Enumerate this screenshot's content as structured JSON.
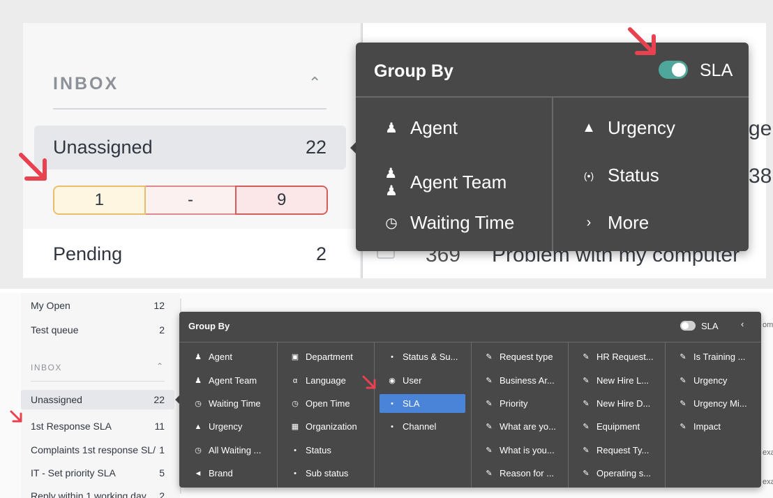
{
  "top": {
    "sidebar": {
      "section_title": "INBOX",
      "active_row": {
        "label": "Unassigned",
        "count": "22"
      },
      "sla_breakdown": [
        "1",
        "-",
        "9"
      ],
      "next_row": {
        "label": "Pending",
        "count": "2"
      }
    },
    "background_fragments": [
      "ge",
      "38",
      "Problem with my computer",
      "369"
    ],
    "popover": {
      "title": "Group By",
      "sla_toggle": {
        "label": "SLA",
        "on": true
      },
      "left_items": [
        {
          "label": "Agent",
          "icon": "person-icon"
        },
        {
          "label": "Agent Team",
          "icon": "people-icon"
        },
        {
          "label": "Waiting Time",
          "icon": "clock-icon"
        }
      ],
      "right_items": [
        {
          "label": "Urgency",
          "icon": "warning-icon"
        },
        {
          "label": "Status",
          "icon": "signal-icon"
        },
        {
          "label": "More",
          "icon": "chevron-right-icon"
        }
      ]
    }
  },
  "bottom": {
    "sidebar": {
      "top_items": [
        {
          "label": "My Open",
          "count": "12"
        },
        {
          "label": "Test queue",
          "count": "2"
        }
      ],
      "section_title": "INBOX",
      "active_row": {
        "label": "Unassigned",
        "count": "22"
      },
      "sla_items": [
        {
          "label": "1st Response SLA",
          "count": "11"
        },
        {
          "label": "Complaints 1st response SL/",
          "count": "1"
        },
        {
          "label": "IT - Set priority SLA",
          "count": "5"
        },
        {
          "label": "Reply within 1 working day",
          "count": "2"
        }
      ]
    },
    "background_fragments": [
      "om",
      "exa",
      "exa"
    ],
    "popover": {
      "title": "Group By",
      "sla_toggle": {
        "label": "SLA",
        "on": false
      },
      "close_icon": "chevron-left-icon",
      "columns": [
        [
          {
            "label": "Agent",
            "icon": "person-icon"
          },
          {
            "label": "Agent Team",
            "icon": "people-icon"
          },
          {
            "label": "Waiting Time",
            "icon": "clock-icon"
          },
          {
            "label": "Urgency",
            "icon": "warning-icon"
          },
          {
            "label": "All Waiting ...",
            "icon": "clock-icon"
          },
          {
            "label": "Brand",
            "icon": "megaphone-icon"
          }
        ],
        [
          {
            "label": "Department",
            "icon": "department-icon"
          },
          {
            "label": "Language",
            "icon": "translate-icon"
          },
          {
            "label": "Open Time",
            "icon": "clock-icon"
          },
          {
            "label": "Organization",
            "icon": "building-icon"
          },
          {
            "label": "Status",
            "icon": "signal-icon"
          },
          {
            "label": "Sub status",
            "icon": "signal-icon"
          }
        ],
        [
          {
            "label": "Status & Su...",
            "icon": "signal-icon"
          },
          {
            "label": "User",
            "icon": "user-circle-icon"
          },
          {
            "label": "SLA",
            "icon": "signal-icon",
            "selected": true
          },
          {
            "label": "Channel",
            "icon": "signal-icon"
          }
        ],
        [
          {
            "label": "Request type",
            "icon": "edit-icon"
          },
          {
            "label": "Business Ar...",
            "icon": "edit-icon"
          },
          {
            "label": "Priority",
            "icon": "edit-icon"
          },
          {
            "label": "What are yo...",
            "icon": "edit-icon"
          },
          {
            "label": "What is you...",
            "icon": "edit-icon"
          },
          {
            "label": "Reason for ...",
            "icon": "edit-icon"
          }
        ],
        [
          {
            "label": "HR Request...",
            "icon": "edit-icon"
          },
          {
            "label": "New Hire L...",
            "icon": "edit-icon"
          },
          {
            "label": "New Hire D...",
            "icon": "edit-icon"
          },
          {
            "label": "Equipment",
            "icon": "edit-icon"
          },
          {
            "label": "Request Ty...",
            "icon": "edit-icon"
          },
          {
            "label": "Operating s...",
            "icon": "edit-icon"
          }
        ],
        [
          {
            "label": "Is Training ...",
            "icon": "edit-icon"
          },
          {
            "label": "Urgency",
            "icon": "edit-icon"
          },
          {
            "label": "Urgency Mi...",
            "icon": "edit-icon"
          },
          {
            "label": "Impact",
            "icon": "edit-icon"
          }
        ]
      ]
    }
  },
  "colors": {
    "popover_bg": "#484848",
    "toggle_on": "#4fa69b",
    "selected_item": "#4a84d8",
    "annotation_arrow": "#e8414f"
  }
}
